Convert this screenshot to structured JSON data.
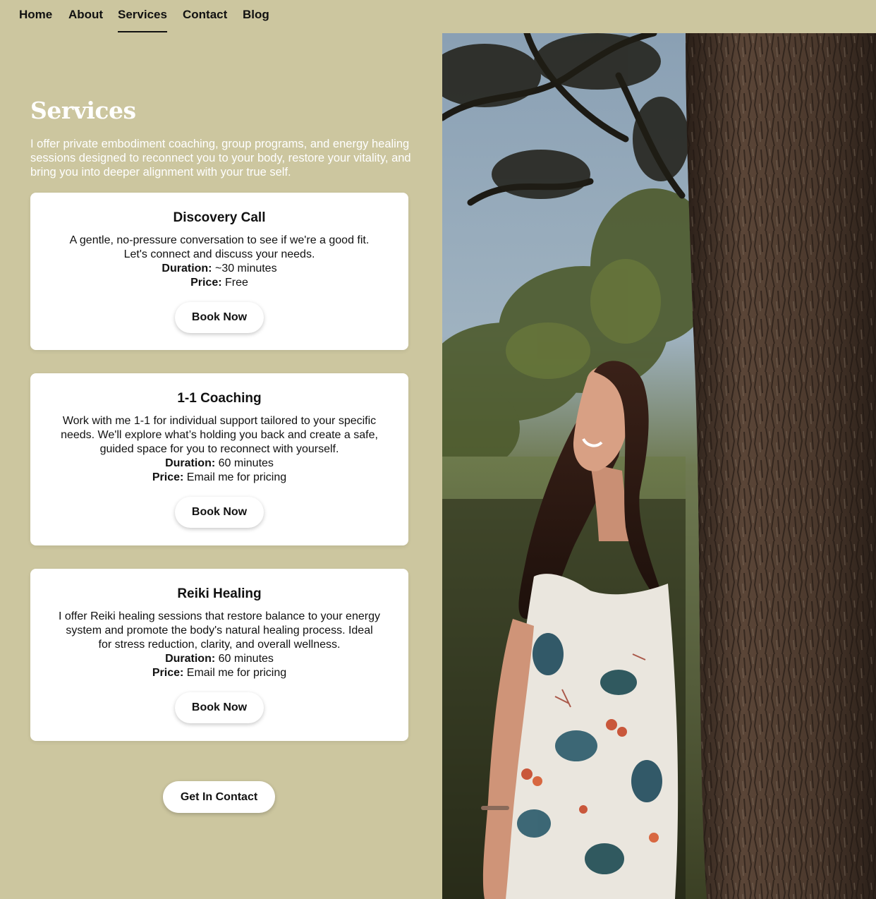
{
  "nav": {
    "items": [
      {
        "label": "Home"
      },
      {
        "label": "About"
      },
      {
        "label": "Services"
      },
      {
        "label": "Contact"
      },
      {
        "label": "Blog"
      }
    ],
    "active": "Services"
  },
  "main": {
    "title": "Services",
    "intro": "I offer private embodiment coaching, group programs, and energy healing sessions designed to reconnect you to your body, restore your vitality, and bring you into deeper alignment with your true self.",
    "cards": [
      {
        "title": "Discovery Call",
        "description_lines": [
          "A gentle, no-pressure conversation to see if we're a good fit.",
          "Let's connect and discuss your needs."
        ],
        "duration_label": "Duration:",
        "duration": "~30 minutes",
        "price_label": "Price:",
        "price": "Free",
        "button": "Book Now"
      },
      {
        "title": "1-1 Coaching",
        "description_lines": [
          "Work with me 1-1 for individual support tailored to your specific",
          "needs. We'll explore what’s holding you back and create a safe,",
          "guided space for you to reconnect with yourself."
        ],
        "duration_label": "Duration:",
        "duration": "60 minutes",
        "price_label": "Price:",
        "price": "Email me for pricing",
        "button": "Book Now"
      },
      {
        "title": "Reiki Healing",
        "description_lines": [
          "I offer Reiki healing sessions that restore balance to your energy",
          "system and promote the body's natural healing process. Ideal",
          "for stress reduction, clarity, and overall wellness."
        ],
        "duration_label": "Duration:",
        "duration": "60 minutes",
        "price_label": "Price:",
        "price": "Email me for pricing",
        "button": "Book Now"
      }
    ],
    "contact_button": "Get In Contact"
  },
  "colors": {
    "page_background": "#ccc69f",
    "card_background": "#ffffff",
    "heading_on_bg": "#ffffff",
    "text": "#111111"
  },
  "image": {
    "alt_subject": "woman in floral dress leaning against tree trunk looking upward"
  }
}
